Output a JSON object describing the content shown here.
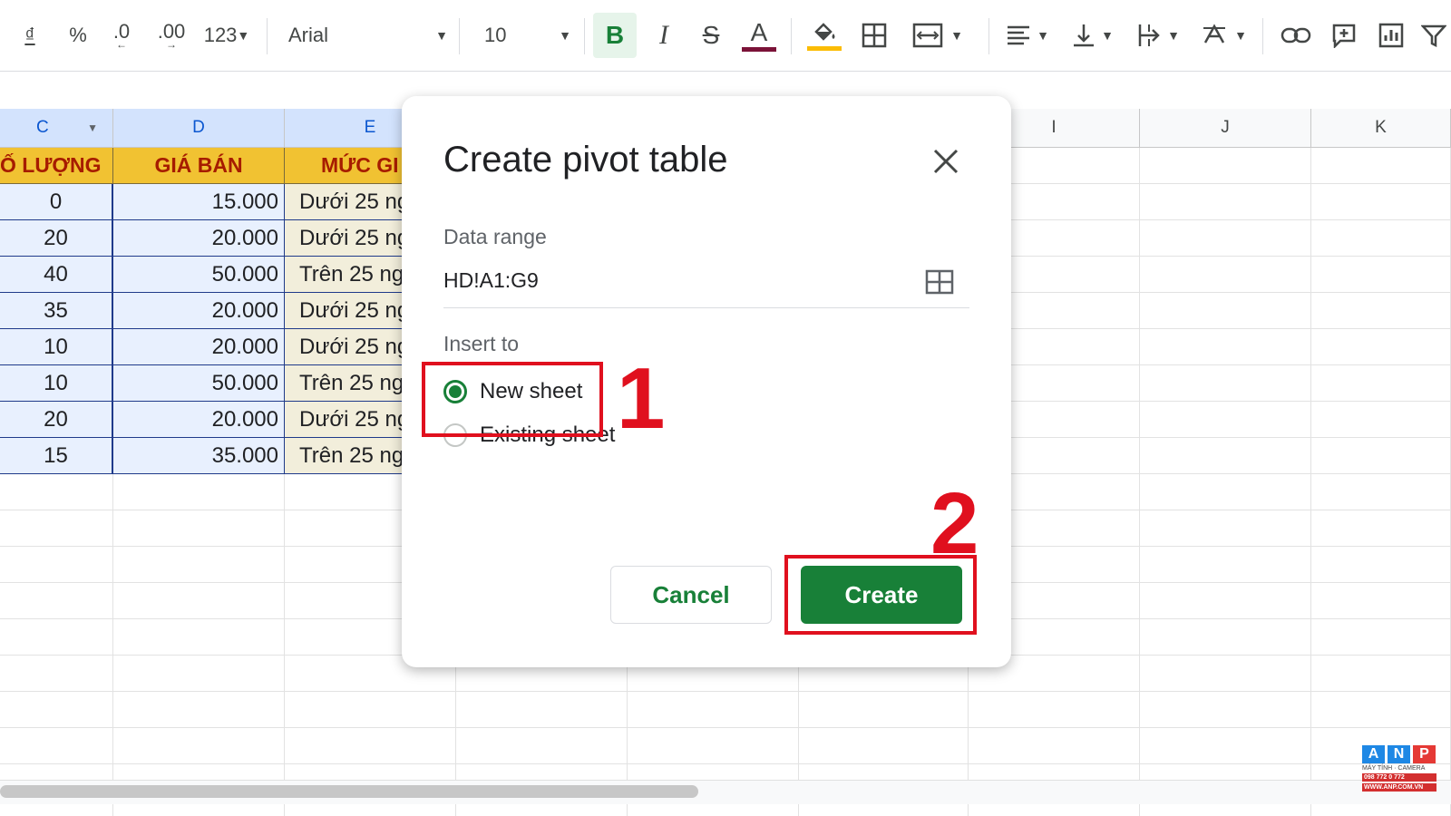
{
  "toolbar": {
    "currency": "₫",
    "percent": "%",
    "dec_decrease": ".0",
    "dec_increase": ".00",
    "format_more": "123",
    "font": "Arial",
    "font_size": "10",
    "bold": "B",
    "italic": "I",
    "strike": "S",
    "text_color_glyph": "A",
    "accent_text_color": "#7b1238",
    "accent_fill_color": "#fbbc04"
  },
  "columns": {
    "C": "C",
    "D": "D",
    "E": "E",
    "I": "I",
    "J": "J",
    "K": "K"
  },
  "table": {
    "headers": [
      "Ố LƯỢNG",
      "GIÁ BÁN",
      "MỨC GI"
    ],
    "rows": [
      [
        "0",
        "15.000",
        "Dưới 25 ng"
      ],
      [
        "20",
        "20.000",
        "Dưới 25 ng"
      ],
      [
        "40",
        "50.000",
        "Trên 25 ng"
      ],
      [
        "35",
        "20.000",
        "Dưới 25 ng"
      ],
      [
        "10",
        "20.000",
        "Dưới 25 ng"
      ],
      [
        "10",
        "50.000",
        "Trên 25 ng"
      ],
      [
        "20",
        "20.000",
        "Dưới 25 ng"
      ],
      [
        "15",
        "35.000",
        "Trên 25 ng"
      ]
    ]
  },
  "dialog": {
    "title": "Create pivot table",
    "data_range_label": "Data range",
    "data_range_value": "HD!A1:G9",
    "insert_to_label": "Insert to",
    "option_new": "New sheet",
    "option_existing": "Existing sheet",
    "selected_option": "New sheet",
    "cancel_label": "Cancel",
    "create_label": "Create",
    "accent_color": "#188038"
  },
  "annotations": {
    "step1": "1",
    "step2": "2",
    "color": "#e0101e"
  },
  "logo": {
    "letters": [
      "A",
      "N",
      "P"
    ],
    "line1": "MÁY TÍNH · CAMERA",
    "line2": "098 772 0 772",
    "line3": "WWW.ANP.COM.VN"
  }
}
